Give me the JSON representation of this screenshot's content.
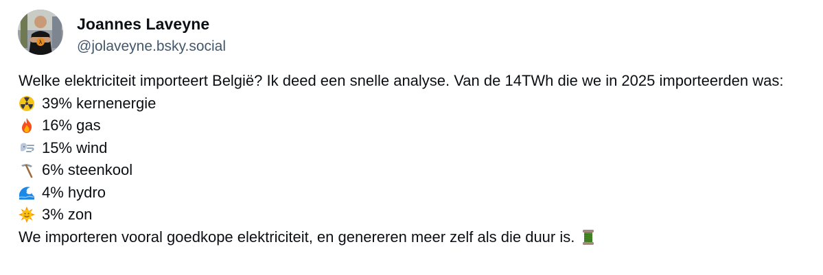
{
  "author": {
    "display_name": "Joannes Laveyne",
    "handle": "@jolaveyne.bsky.social",
    "avatar_icon": "avatar"
  },
  "post": {
    "intro": "Welke elektriciteit importeert België? Ik deed een snelle analyse. Van de 14TWh die we in 2025 importeerden was:",
    "items": [
      {
        "icon": "radioactive-icon",
        "text": "39% kernenergie"
      },
      {
        "icon": "fire-icon",
        "text": "16% gas"
      },
      {
        "icon": "wind-face-icon",
        "text": "15% wind"
      },
      {
        "icon": "pick-icon",
        "text": "6% steenkool"
      },
      {
        "icon": "water-wave-icon",
        "text": "4% hydro"
      },
      {
        "icon": "sun-with-face-icon",
        "text": "3% zon"
      }
    ],
    "outro": "We importeren vooral goedkope elektriciteit, en genereren meer zelf als die duur is.",
    "outro_icon": "thread-spool-icon"
  }
}
